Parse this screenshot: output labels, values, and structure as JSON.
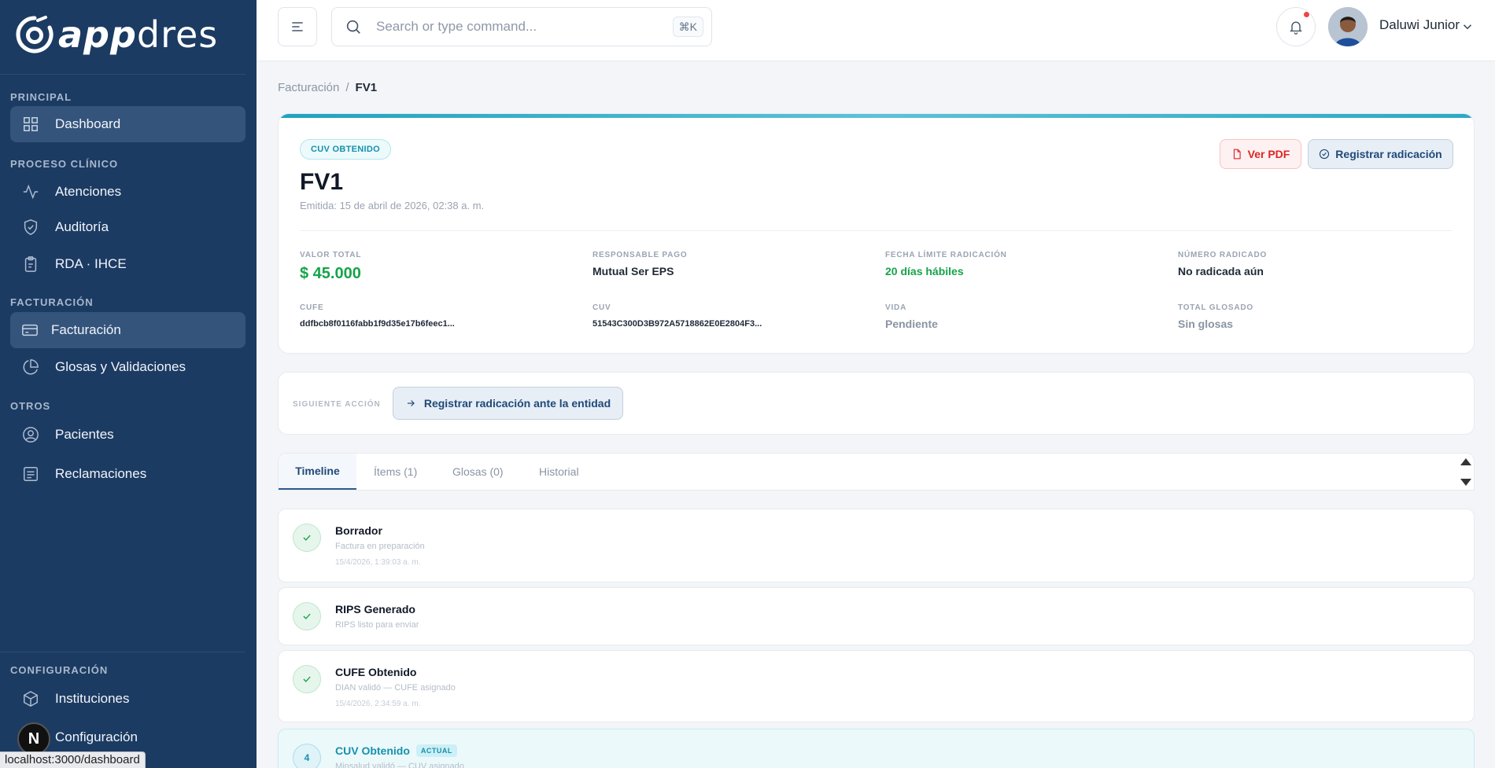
{
  "sidebar": {
    "logo_bold": "app",
    "logo_light": "dres",
    "sections": {
      "principal": "PRINCIPAL",
      "proceso": "PROCESO CLÍNICO",
      "facturacion": "FACTURACIÓN",
      "otros": "OTROS",
      "configuracion": "CONFIGURACIÓN"
    },
    "items": {
      "dashboard": "Dashboard",
      "atenciones": "Atenciones",
      "auditoria": "Auditoría",
      "rda": "RDA · IHCE",
      "facturacion": "Facturación",
      "glosas": "Glosas y Validaciones",
      "pacientes": "Pacientes",
      "reclamaciones": "Reclamaciones",
      "instituciones": "Instituciones",
      "configuracion": "Configuración"
    },
    "n_badge": "N"
  },
  "status_url": "localhost:3000/dashboard",
  "topbar": {
    "search_placeholder": "Search or type command...",
    "shortcut": "⌘K",
    "user_name": "Daluwi Junior"
  },
  "breadcrumb": {
    "parent": "Facturación",
    "separator": "/",
    "current": "FV1"
  },
  "invoice": {
    "status_pill": "CUV OBTENIDO",
    "title": "FV1",
    "emitida": "Emitida: 15 de abril de 2026, 02:38 a. m.",
    "btn_pdf": "Ver PDF",
    "btn_registrar": "Registrar radicación",
    "fields": {
      "valor_total_label": "VALOR TOTAL",
      "valor_total": "$ 45.000",
      "responsable_label": "RESPONSABLE PAGO",
      "responsable": "Mutual Ser EPS",
      "fecha_limite_label": "FECHA LÍMITE RADICACIÓN",
      "fecha_limite": "20 días hábiles",
      "numero_label": "NÚMERO RADICADO",
      "numero": "No radicada aún",
      "cufe_label": "CUFE",
      "cufe": "ddfbcb8f0116fabb1f9d35e17b6feec1...",
      "cuv_label": "CUV",
      "cuv": "51543C300D3B972A5718862E0E2804F3...",
      "vida_label": "VIDA",
      "vida": "Pendiente",
      "glosado_label": "TOTAL GLOSADO",
      "glosado": "Sin glosas"
    }
  },
  "next_action": {
    "label": "SIGUIENTE ACCIÓN",
    "button": "Registrar radicación ante la entidad"
  },
  "tabs": {
    "timeline": "Timeline",
    "items": "Ítems (1)",
    "glosas": "Glosas (0)",
    "historial": "Historial"
  },
  "timeline": [
    {
      "title": "Borrador",
      "desc": "Factura en preparación",
      "date": "15/4/2026, 1:39:03 a. m."
    },
    {
      "title": "RIPS Generado",
      "desc": "RIPS listo para enviar",
      "date": ""
    },
    {
      "title": "CUFE Obtenido",
      "desc": "DIAN validó — CUFE asignado",
      "date": "15/4/2026, 2:34:59 a. m."
    },
    {
      "title": "CUV Obtenido",
      "tag": "ACTUAL",
      "number": "4",
      "desc": "Minsalud validó — CUV asignado"
    }
  ],
  "colors": {
    "sidebar_bg": "#1c3b63",
    "accent_cyan": "#1591ad",
    "success_green": "#16a34a",
    "danger_red": "#dc2626"
  }
}
